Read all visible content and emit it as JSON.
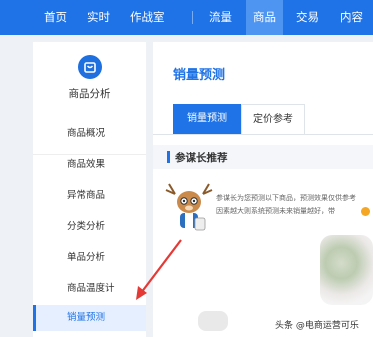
{
  "topnav": {
    "items": [
      {
        "label": "首页"
      },
      {
        "label": "实时"
      },
      {
        "label": "作战室"
      },
      {
        "label": "流量"
      },
      {
        "label": "商品"
      },
      {
        "label": "交易"
      },
      {
        "label": "内容"
      }
    ],
    "active_index": 4
  },
  "sidebar": {
    "icon": "shopping-bag-icon",
    "title": "商品分析",
    "items": [
      {
        "label": "商品概况"
      },
      {
        "label": "商品效果"
      },
      {
        "label": "异常商品"
      },
      {
        "label": "分类分析"
      },
      {
        "label": "单品分析"
      },
      {
        "label": "商品温度计"
      },
      {
        "label": "销量预测"
      }
    ],
    "active_index": 6
  },
  "main": {
    "title": "销量预测",
    "tabs": [
      {
        "label": "销量预测"
      },
      {
        "label": "定价参考"
      }
    ],
    "active_tab": 0,
    "section_title": "参谋长推荐",
    "description_lines": [
      "参谋长为您预测以下商品，预测效果仅供参考",
      "因素越大则系统预测未来销量越好，带"
    ]
  },
  "watermark": "头条 @电商运营可乐",
  "colors": {
    "brand": "#1f73e6",
    "nav_active": "#4e95f2",
    "annotation_arrow": "#e53935"
  }
}
